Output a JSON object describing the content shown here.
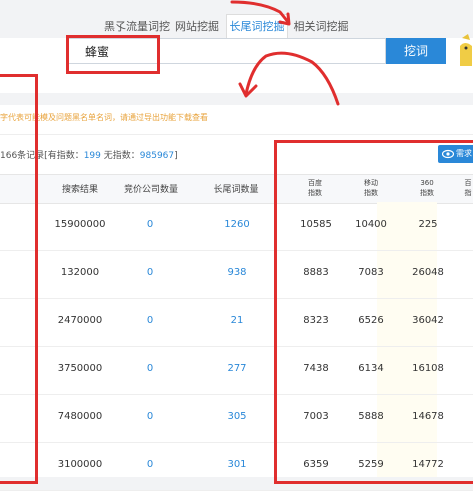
{
  "tabs": [
    {
      "label": "黑孓流量词挖掘"
    },
    {
      "label": "网站挖掘"
    },
    {
      "label": "长尾词挖掘",
      "active": true
    },
    {
      "label": "相关词挖掘"
    }
  ],
  "search": {
    "value": "蜂蜜",
    "button_label": "挖词"
  },
  "notice": "字代表可能模及问题黑名单名词，请通过导出功能下载查看",
  "summary": {
    "prefix": "166条记录[有指数：",
    "with_index": "199",
    "mid": " 无指数：",
    "without_index": "985967",
    "suffix": "]"
  },
  "export_label": "需求",
  "table": {
    "headers": [
      "搜索结果",
      "竞价公司数量",
      "长尾词数量"
    ],
    "index_headers": [
      {
        "line1": "百度",
        "line2": "指数"
      },
      {
        "line1": "移动",
        "line2": "指数"
      },
      {
        "line1": "360",
        "line2": "指数"
      },
      {
        "line1": "百",
        "line2": "指"
      }
    ],
    "rows": [
      {
        "results": "15900000",
        "companies": "0",
        "longtail": "1260",
        "baidu": "10585",
        "mobile": "10400",
        "idx360": "225"
      },
      {
        "results": "132000",
        "companies": "0",
        "longtail": "938",
        "baidu": "8883",
        "mobile": "7083",
        "idx360": "26048"
      },
      {
        "results": "2470000",
        "companies": "0",
        "longtail": "21",
        "baidu": "8323",
        "mobile": "6526",
        "idx360": "36042"
      },
      {
        "results": "3750000",
        "companies": "0",
        "longtail": "277",
        "baidu": "7438",
        "mobile": "6134",
        "idx360": "16108"
      },
      {
        "results": "7480000",
        "companies": "0",
        "longtail": "305",
        "baidu": "7003",
        "mobile": "5888",
        "idx360": "14678"
      },
      {
        "results": "3100000",
        "companies": "0",
        "longtail": "301",
        "baidu": "6359",
        "mobile": "5259",
        "idx360": "14772"
      }
    ]
  },
  "colors": {
    "accent": "#2a88d8",
    "annotation": "#e02e2e",
    "notice": "#e8a33c"
  }
}
